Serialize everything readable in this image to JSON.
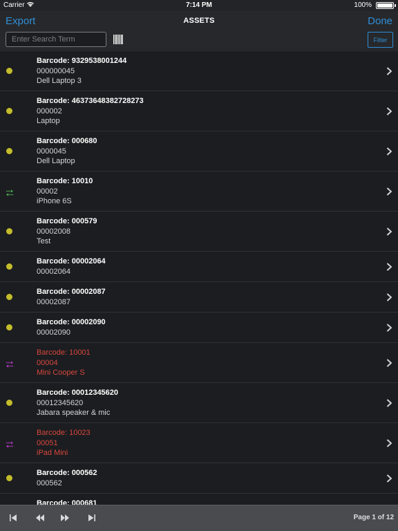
{
  "status_bar": {
    "carrier": "Carrier",
    "time": "7:14 PM",
    "battery": "100%",
    "battery_level": 1.0
  },
  "nav": {
    "export_label": "Export",
    "title": "ASSETS",
    "done_label": "Done"
  },
  "search": {
    "placeholder": "Enter Search Term",
    "value": "",
    "barcode_icon": "barcode-scanner-icon",
    "filter_label": "Filter"
  },
  "colors": {
    "accent": "#2f8fd8",
    "status_dot": "#c4bd2b",
    "transfer_in": "#4caf50",
    "transfer_out": "#b43ac8",
    "alert_text": "#d7473e"
  },
  "assets": [
    {
      "barcode": "Barcode: 9329538001244",
      "number": "000000045",
      "name": "Dell Laptop 3",
      "status": "available",
      "alert": false
    },
    {
      "barcode": "Barcode: 46373648382728273",
      "number": "000002",
      "name": "Laptop",
      "status": "available",
      "alert": false
    },
    {
      "barcode": "Barcode: 000680",
      "number": "0000045",
      "name": "Dell Laptop",
      "status": "available",
      "alert": false
    },
    {
      "barcode": "Barcode: 10010",
      "number": "00002",
      "name": "iPhone 6S",
      "status": "transfer-green",
      "alert": false
    },
    {
      "barcode": "Barcode: 000579",
      "number": "00002008",
      "name": "Test",
      "status": "available",
      "alert": false
    },
    {
      "barcode": "Barcode: 00002064",
      "number": "00002064",
      "name": "",
      "status": "available",
      "alert": false
    },
    {
      "barcode": "Barcode: 00002087",
      "number": "00002087",
      "name": "",
      "status": "available",
      "alert": false
    },
    {
      "barcode": "Barcode: 00002090",
      "number": "00002090",
      "name": "",
      "status": "available",
      "alert": false
    },
    {
      "barcode": "Barcode: 10001",
      "number": "00004",
      "name": "Mini Cooper S",
      "status": "transfer-purple",
      "alert": true
    },
    {
      "barcode": "Barcode: 00012345620",
      "number": "00012345620",
      "name": "Jabara speaker & mic",
      "status": "available",
      "alert": false
    },
    {
      "barcode": "Barcode: 10023",
      "number": "00051",
      "name": "iPad Mini",
      "status": "transfer-purple",
      "alert": true
    },
    {
      "barcode": "Barcode: 000562",
      "number": "000562",
      "name": "",
      "status": "available",
      "alert": false
    },
    {
      "barcode": "Barcode: 000681",
      "number": "",
      "name": "",
      "status": "available",
      "alert": false
    }
  ],
  "toolbar": {
    "first_icon": "first-page-icon",
    "prev_icon": "previous-page-icon",
    "next_icon": "next-page-icon",
    "last_icon": "last-page-icon",
    "page_label": "Page 1 of 12"
  }
}
